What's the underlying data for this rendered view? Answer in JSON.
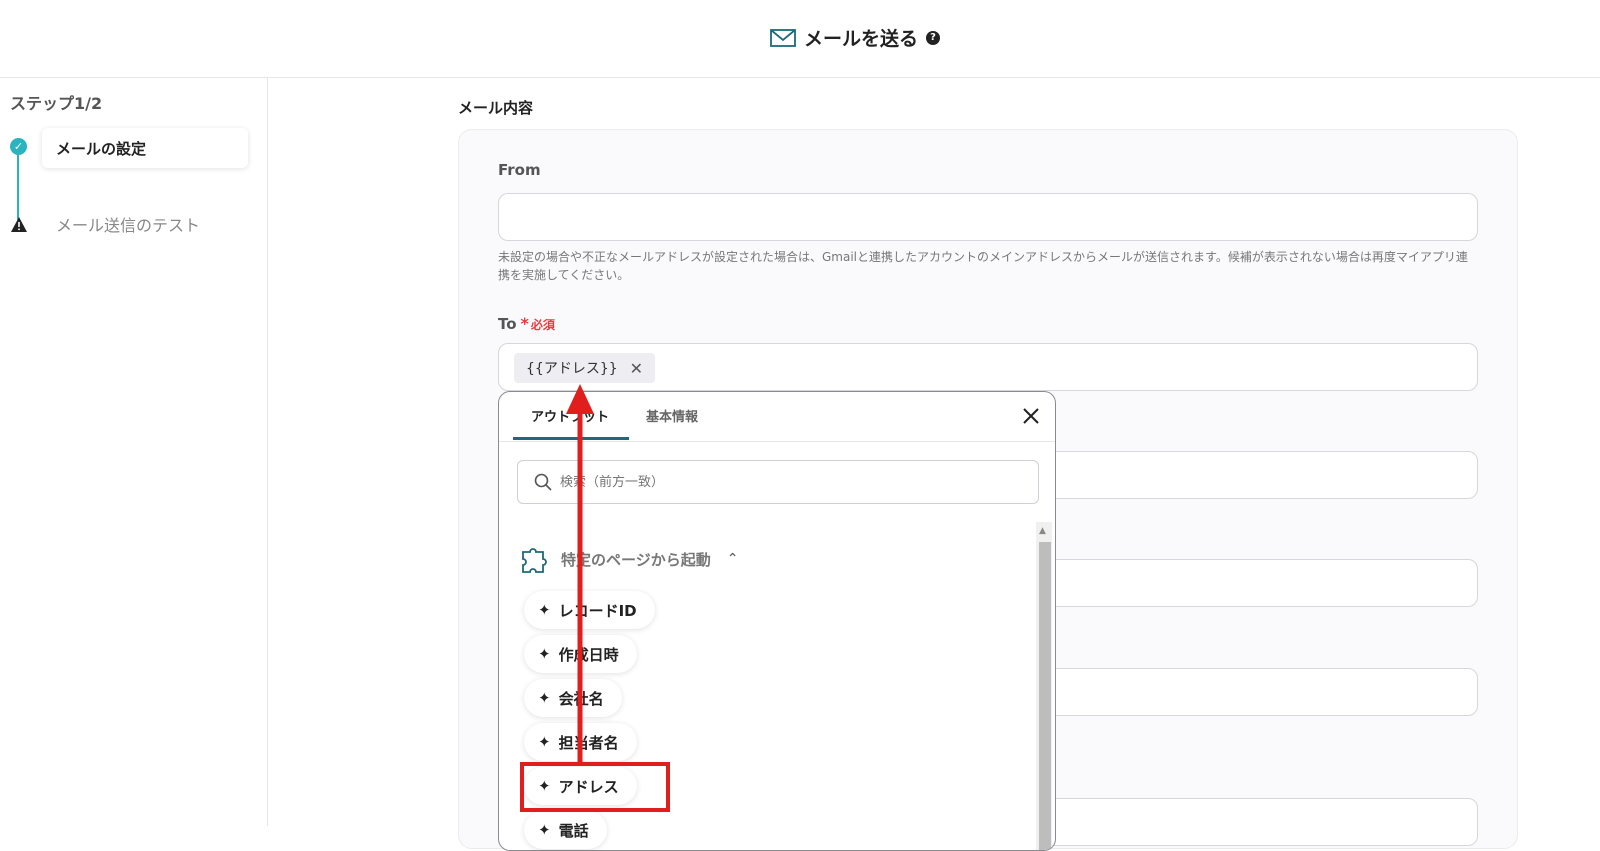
{
  "header": {
    "title": "メールを送る",
    "help": "?"
  },
  "sidebar": {
    "step_title": "ステップ1/2",
    "steps": [
      {
        "label": "メールの設定",
        "status": "done"
      },
      {
        "label": "メール送信のテスト",
        "status": "warning"
      }
    ]
  },
  "main": {
    "section_title": "メール内容",
    "from": {
      "label": "From",
      "value": "",
      "help": "未設定の場合や不正なメールアドレスが設定された場合は、Gmailと連携したアカウントのメインアドレスからメールが送信されます。候補が表示されない場合は再度マイアプリ連携を実施してください。"
    },
    "to": {
      "label": "To",
      "required_mark": "*",
      "required_label": "必須",
      "chip": "{{アドレス}}"
    }
  },
  "dropdown": {
    "tabs": [
      "アウトプット",
      "基本情報"
    ],
    "search_placeholder": "検索（前方一致）",
    "group_label": "特定のページから起動",
    "items": [
      "レコードID",
      "作成日時",
      "会社名",
      "担当者名",
      "アドレス",
      "電話"
    ]
  },
  "colors": {
    "accent": "#2bb3c0",
    "tab_underline": "#1d6a78",
    "highlight": "#e01e1e",
    "required": "#e53e3e"
  },
  "icons": [
    "mail-icon",
    "help-icon",
    "check-icon",
    "warning-icon",
    "close-icon",
    "search-icon",
    "puzzle-icon",
    "chevron-up-icon"
  ]
}
